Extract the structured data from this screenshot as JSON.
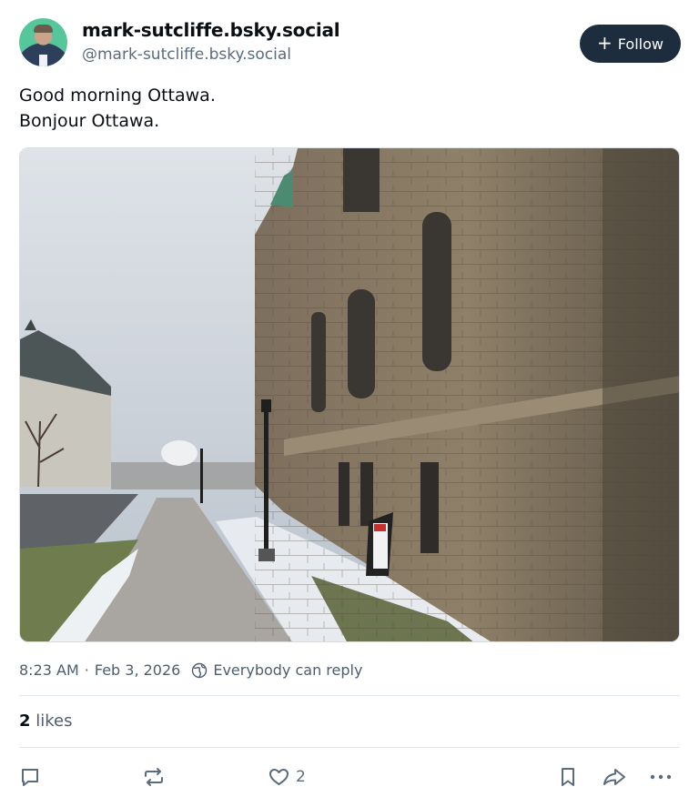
{
  "author": {
    "display_name": "mark-sutcliffe.bsky.social",
    "handle": "@mark-sutcliffe.bsky.social",
    "avatar_icon": "profile-photo"
  },
  "follow_button": {
    "label": "Follow",
    "icon": "plus-icon"
  },
  "post": {
    "lines": [
      "Good morning Ottawa.",
      "Bonjour Ottawa."
    ],
    "image_icon": "photo-stone-building-sidewalk-snow"
  },
  "meta": {
    "time": "8:23 AM",
    "separator": "·",
    "date": "Feb 3, 2026",
    "reply_setting": "Everybody can reply",
    "reply_icon": "globe-icon"
  },
  "likes": {
    "count": "2",
    "label": "likes"
  },
  "actions": {
    "reply_icon": "comment-icon",
    "repost_icon": "repost-icon",
    "like_icon": "heart-icon",
    "like_count": "2",
    "bookmark_icon": "bookmark-icon",
    "share_icon": "share-icon",
    "more_icon": "more-icon"
  },
  "colors": {
    "follow_bg": "#1e2d3d",
    "muted_text": "#4e5d6f",
    "divider": "#e3e8ee"
  }
}
